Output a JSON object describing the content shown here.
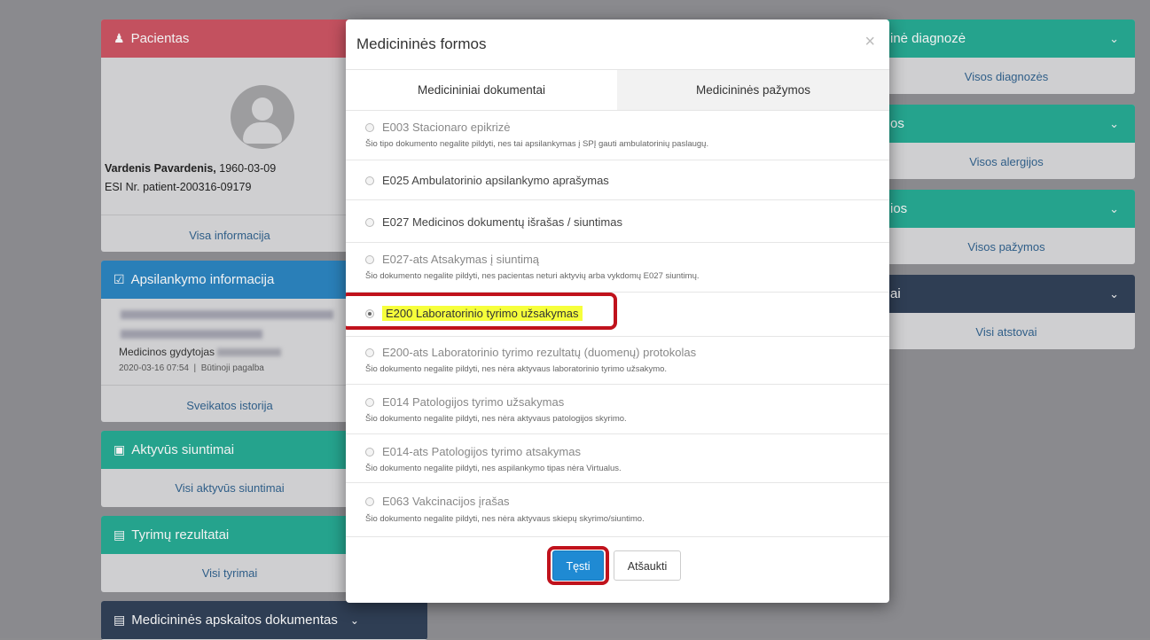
{
  "left": {
    "patient": {
      "title": "Pacientas",
      "name": "Vardenis Pavardenis,",
      "dob": "1960-03-09",
      "esi": "ESI Nr. patient-200316-09179",
      "link": "Visa informacija"
    },
    "visit": {
      "title": "Apsilankymo informacija",
      "doctor": "Medicinos gydytojas",
      "datetime": "2020-03-16 07:54",
      "type": "Būtinoji pagalba",
      "link": "Sveikatos istorija"
    },
    "referrals": {
      "title": "Aktyvūs siuntimai",
      "link": "Visi aktyvūs siuntimai"
    },
    "results": {
      "title": "Tyrimų rezultatai",
      "link": "Visi tyrimai"
    },
    "records": {
      "title": "Medicininės apskaitos dokumentas"
    }
  },
  "right": {
    "diagnosis": {
      "title": "inė diagnozė",
      "link": "Visos diagnozės"
    },
    "allergies": {
      "title": "os",
      "link": "Visos alergijos"
    },
    "certificates": {
      "title": "ios",
      "link": "Visos pažymos"
    },
    "reps": {
      "title": "ai",
      "link": "Visi atstovai"
    }
  },
  "modal": {
    "title": "Medicininės formos",
    "close": "×",
    "tabs": [
      "Medicininiai dokumentai",
      "Medicininės pažymos"
    ],
    "options": [
      {
        "label": "E003 Stacionaro epikrizė",
        "note": "Šio tipo dokumento negalite pildyti, nes tai apsilankymas į SPĮ gauti ambulatorinių paslaugų.",
        "disabled": true
      },
      {
        "label": "E025 Ambulatorinio apsilankymo aprašymas",
        "note": "",
        "disabled": false
      },
      {
        "label": "E027 Medicinos dokumentų išrašas / siuntimas",
        "note": "",
        "disabled": false
      },
      {
        "label": "E027-ats Atsakymas į siuntimą",
        "note": "Šio dokumento negalite pildyti, nes pacientas neturi aktyvių arba vykdomų E027 siuntimų.",
        "disabled": true
      },
      {
        "label": "E200 Laboratorinio tyrimo užsakymas",
        "note": "",
        "disabled": false,
        "selected": true
      },
      {
        "label": "E200-ats Laboratorinio tyrimo rezultatų (duomenų) protokolas",
        "note": "Šio dokumento negalite pildyti, nes nėra aktyvaus laboratorinio tyrimo užsakymo.",
        "disabled": true
      },
      {
        "label": "E014 Patologijos tyrimo užsakymas",
        "note": "Šio dokumento negalite pildyti, nes nėra aktyvaus patologijos skyrimo.",
        "disabled": true
      },
      {
        "label": "E014-ats Patologijos tyrimo atsakymas",
        "note": "Šio dokumento negalite pildyti, nes aspilankymo tipas nėra Virtualus.",
        "disabled": true
      },
      {
        "label": "E063 Vakcinacijos įrašas",
        "note": "Šio dokumento negalite pildyti, nes nėra aktyvaus skiepų skyrimo/siuntimo.",
        "disabled": true
      }
    ],
    "continue_label": "Tęsti",
    "cancel_label": "Atšaukti"
  },
  "colors": {
    "patient_head": "#c3515f",
    "visit_head": "#2a7fb8",
    "green_head": "#25a38d",
    "dark_head": "#2f3e54",
    "primary": "#1f8ad3",
    "highlight": "#f6ff3b",
    "annotation": "#c0121c"
  }
}
